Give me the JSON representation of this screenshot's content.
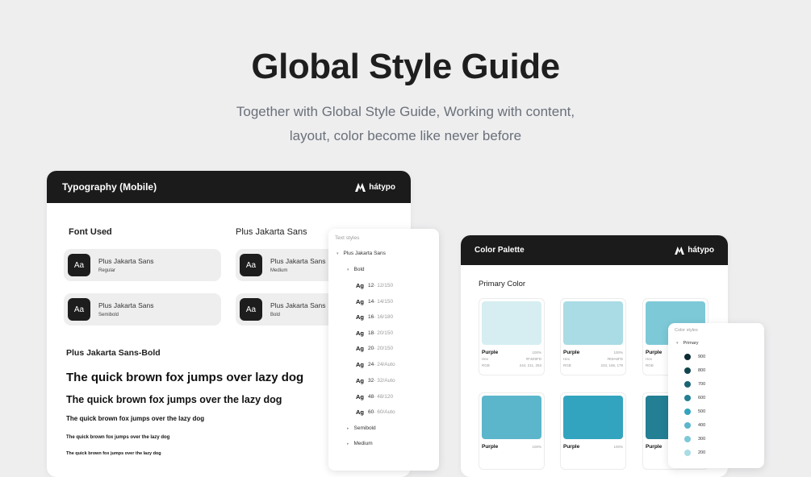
{
  "hero": {
    "title": "Global Style Guide",
    "subtitle_line1": "Together with Global Style Guide, Working with content,",
    "subtitle_line2": "layout, color become like never before"
  },
  "typography_card": {
    "title": "Typography (Mobile)",
    "logo_text": "hátypo",
    "font_used_label": "Font Used",
    "font_family_label": "Plus Jakarta Sans",
    "font_tiles": [
      {
        "icon": "Aa",
        "name": "Plus Jakarta Sans",
        "weight": "Regular"
      },
      {
        "icon": "Aa",
        "name": "Plus Jakarta Sans",
        "weight": "Medium"
      },
      {
        "icon": "Aa",
        "name": "Plus Jakarta Sans",
        "weight": "Semibold"
      },
      {
        "icon": "Aa",
        "name": "Plus Jakarta Sans",
        "weight": "Bold"
      }
    ],
    "sample_heading": "Plus Jakarta Sans-Bold",
    "samples": [
      "The quick brown fox jumps over lazy dog",
      "The quick brown fox jumps over the lazy dog",
      "The quick brown fox jumps over the lazy dog",
      "The quick brown fox jumps over the lazy dog",
      "The quick brown fox jumps over the lazy dog"
    ]
  },
  "text_styles_panel": {
    "header": "Text styles",
    "group": "Plus Jakarta Sans",
    "subgroup": "Bold",
    "items": [
      {
        "prefix": "Ag",
        "size": "12",
        "spec": " - 12/150"
      },
      {
        "prefix": "Ag",
        "size": "14",
        "spec": " - 14/150"
      },
      {
        "prefix": "Ag",
        "size": "16",
        "spec": " - 16/180"
      },
      {
        "prefix": "Ag",
        "size": "18",
        "spec": " - 20/150"
      },
      {
        "prefix": "Ag",
        "size": "20",
        "spec": " - 20/150"
      },
      {
        "prefix": "Ag",
        "size": "24",
        "spec": " - 24/Auto"
      },
      {
        "prefix": "Ag",
        "size": "32",
        "spec": " - 32/Auto"
      },
      {
        "prefix": "Ag",
        "size": "48",
        "spec": " - 48/120"
      },
      {
        "prefix": "Ag",
        "size": "60",
        "spec": " - 60/Auto"
      }
    ],
    "collapsed": [
      "Semibold",
      "Medium"
    ]
  },
  "color_card": {
    "title": "Color Palette",
    "logo_text": "hátypo",
    "section_label": "Primary Color",
    "swatches": [
      {
        "color": "#d6eef2",
        "name": "Purple",
        "pct": "100%",
        "hex_label": "Hex",
        "hex": "#F4E9FD",
        "rgb_label": "RGB",
        "rgb": "244, 211, 253"
      },
      {
        "color": "#a9dce5",
        "name": "Purple",
        "pct": "100%",
        "hex_label": "Hex",
        "hex": "#E9A6FD",
        "rgb_label": "RGB",
        "rgb": "233, 166, 179"
      },
      {
        "color": "#7dc9d8",
        "name": "Purple",
        "pct": "",
        "hex_label": "Hex",
        "hex": "",
        "rgb_label": "RGB",
        "rgb": ""
      },
      {
        "color": "#5bb6cb",
        "name": "Purple",
        "pct": "100%",
        "hex_label": "",
        "hex": "",
        "rgb_label": "",
        "rgb": ""
      },
      {
        "color": "#33a4bf",
        "name": "Purple",
        "pct": "100%",
        "hex_label": "",
        "hex": "",
        "rgb_label": "",
        "rgb": ""
      },
      {
        "color": "#237f93",
        "name": "Purple",
        "pct": "",
        "hex_label": "",
        "hex": "",
        "rgb_label": "",
        "rgb": ""
      }
    ]
  },
  "color_styles_panel": {
    "header": "Color styles",
    "group": "Primary",
    "items": [
      {
        "label": "900",
        "color": "#0d2b33"
      },
      {
        "label": "800",
        "color": "#124450"
      },
      {
        "label": "700",
        "color": "#1a6373"
      },
      {
        "label": "600",
        "color": "#237f93"
      },
      {
        "label": "500",
        "color": "#33a4bf"
      },
      {
        "label": "400",
        "color": "#5bb6cb"
      },
      {
        "label": "300",
        "color": "#7dc9d8"
      },
      {
        "label": "200",
        "color": "#a9dce5"
      }
    ]
  }
}
